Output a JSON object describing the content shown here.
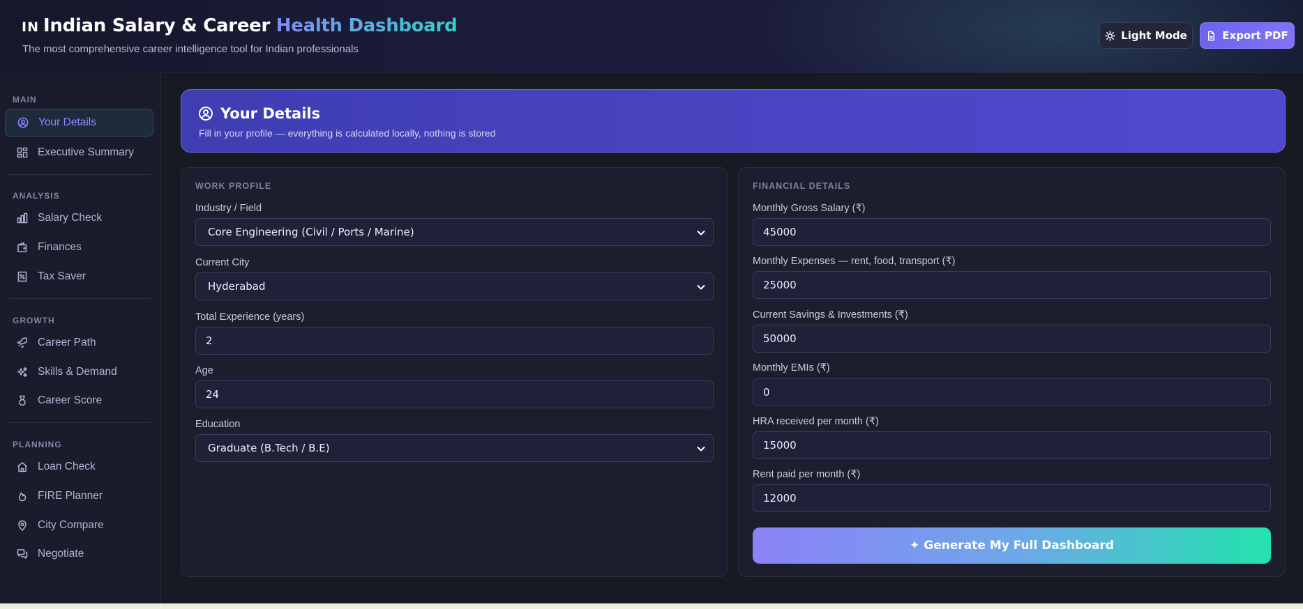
{
  "header": {
    "flag_text": "IN",
    "title_main": "Indian Salary & Career",
    "title_accent": "Health Dashboard",
    "subtitle": "The most comprehensive career intelligence tool for Indian professionals",
    "light_mode_label": "Light Mode",
    "export_label": "Export PDF"
  },
  "sidebar": {
    "sections": {
      "main": "MAIN",
      "analysis": "ANALYSIS",
      "growth": "GROWTH",
      "planning": "PLANNING"
    },
    "items": {
      "your_details": "Your Details",
      "executive_summary": "Executive Summary",
      "salary_check": "Salary Check",
      "finances": "Finances",
      "tax_saver": "Tax Saver",
      "career_path": "Career Path",
      "skills_demand": "Skills & Demand",
      "career_score": "Career Score",
      "loan_check": "Loan Check",
      "fire_planner": "FIRE Planner",
      "city_compare": "City Compare",
      "negotiate": "Negotiate"
    },
    "active": "your_details"
  },
  "banner": {
    "title": "Your Details",
    "subtitle": "Fill in your profile — everything is calculated locally, nothing is stored"
  },
  "work_profile": {
    "heading": "WORK PROFILE",
    "industry_label": "Industry / Field",
    "industry_value": "Core Engineering (Civil / Ports / Marine)",
    "city_label": "Current City",
    "city_value": "Hyderabad",
    "experience_label": "Total Experience (years)",
    "experience_value": "2",
    "age_label": "Age",
    "age_value": "24",
    "education_label": "Education",
    "education_value": "Graduate (B.Tech / B.E)"
  },
  "financial_details": {
    "heading": "FINANCIAL DETAILS",
    "salary_label": "Monthly Gross Salary (₹)",
    "salary_value": "45000",
    "expenses_label": "Monthly Expenses — rent, food, transport (₹)",
    "expenses_value": "25000",
    "savings_label": "Current Savings & Investments (₹)",
    "savings_value": "50000",
    "emi_label": "Monthly EMIs (₹)",
    "emi_value": "0",
    "hra_label": "HRA received per month (₹)",
    "hra_value": "15000",
    "rent_label": "Rent paid per month (₹)",
    "rent_value": "12000",
    "generate_label": "✦ Generate My Full Dashboard"
  }
}
